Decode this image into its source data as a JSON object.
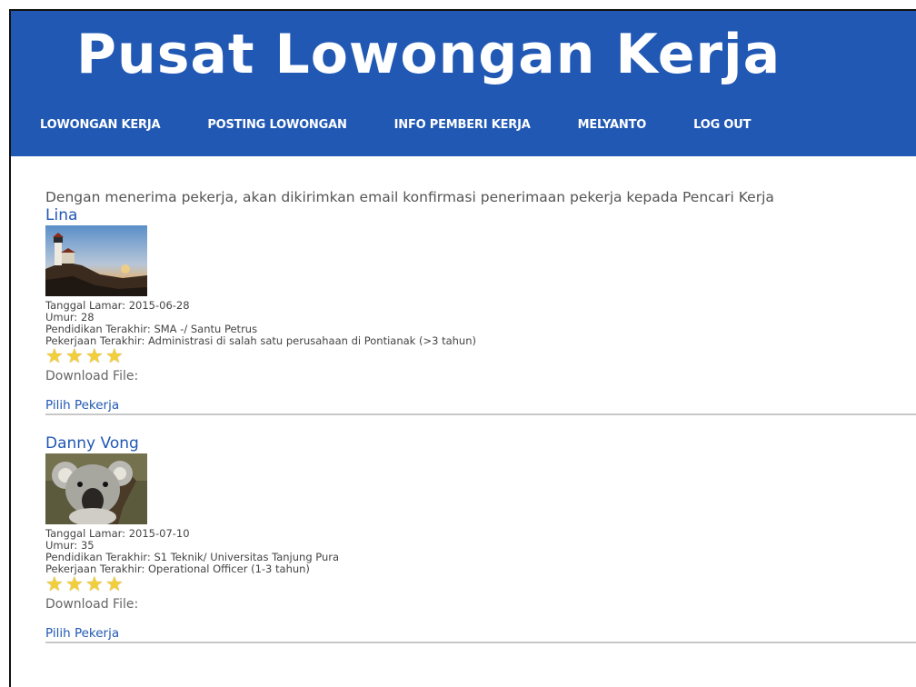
{
  "site": {
    "title": "Pusat Lowongan Kerja"
  },
  "nav": {
    "items": [
      {
        "label": "LOWONGAN KERJA"
      },
      {
        "label": "POSTING LOWONGAN"
      },
      {
        "label": "INFO PEMBERI KERJA"
      },
      {
        "label": "MELYANTO"
      },
      {
        "label": "LOG OUT"
      }
    ]
  },
  "main": {
    "intro": "Dengan menerima pekerja, akan dikirimkan email konfirmasi penerimaan pekerja kepada Pencari Kerja",
    "applicants": [
      {
        "name": "Lina",
        "apply_date": "Tanggal Lamar: 2015-06-28",
        "age": "Umur: 28",
        "education": "Pendidikan Terakhir: SMA -/ Santu Petrus",
        "last_job": "Pekerjaan Terakhir: Administrasi di salah satu perusahaan di Pontianak (>3 tahun)",
        "rating": 4,
        "download": "Download File:",
        "pick": "Pilih Pekerja",
        "photo_icon": "lighthouse-photo"
      },
      {
        "name": "Danny Vong",
        "apply_date": "Tanggal Lamar: 2015-07-10",
        "age": "Umur: 35",
        "education": "Pendidikan Terakhir: S1 Teknik/ Universitas Tanjung Pura",
        "last_job": "Pekerjaan Terakhir: Operational Officer (1-3 tahun)",
        "rating": 4,
        "download": "Download File:",
        "pick": "Pilih Pekerja",
        "photo_icon": "koala-photo"
      }
    ]
  },
  "colors": {
    "header_bg": "#2158b4",
    "link": "#2158b4",
    "star": "#f2cf3a"
  }
}
